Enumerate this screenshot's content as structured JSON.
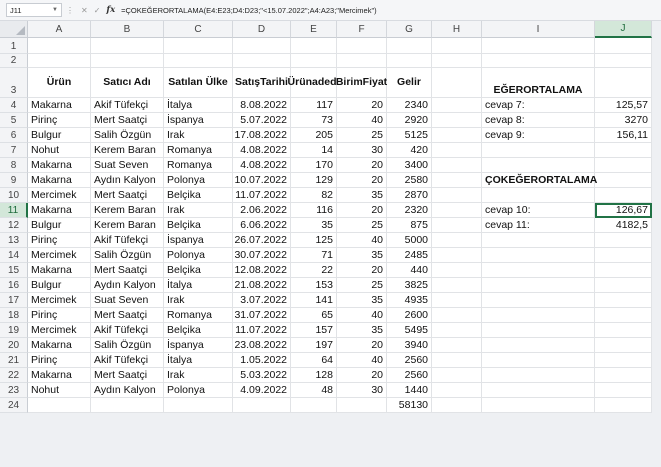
{
  "formula_bar": {
    "name_box": "J11",
    "fx": "fx",
    "formula": "=ÇOKEĞERORTALAMA(E4:E23;D4:D23;\"<15.07.2022\";A4:A23;\"Mercimek\")"
  },
  "columns": [
    "A",
    "B",
    "C",
    "D",
    "E",
    "F",
    "G",
    "H",
    "I",
    "J"
  ],
  "selected_column": "J",
  "selected_row": "11",
  "headers": {
    "urun": "Ürün",
    "satici": "Satıcı Adı",
    "ulke": "Satılan Ülke",
    "tarih_1": "Satış",
    "tarih_2": "Tarihi",
    "adet_1": "Ürün",
    "adet_2": "adedi",
    "fiyat_1": "Birim",
    "fiyat_2": "Fiyat",
    "gelir": "Gelir"
  },
  "rows": [
    [
      "Makarna",
      "Akif Tüfekçi",
      "İtalya",
      "8.08.2022",
      "117",
      "20",
      "2340"
    ],
    [
      "Pirinç",
      "Mert Saatçi",
      "İspanya",
      "5.07.2022",
      "73",
      "40",
      "2920"
    ],
    [
      "Bulgur",
      "Salih Özgün",
      "Irak",
      "17.08.2022",
      "205",
      "25",
      "5125"
    ],
    [
      "Nohut",
      "Kerem Baran",
      "Romanya",
      "4.08.2022",
      "14",
      "30",
      "420"
    ],
    [
      "Makarna",
      "Suat Seven",
      "Romanya",
      "4.08.2022",
      "170",
      "20",
      "3400"
    ],
    [
      "Makarna",
      "Aydın Kalyon",
      "Polonya",
      "10.07.2022",
      "129",
      "20",
      "2580"
    ],
    [
      "Mercimek",
      "Mert Saatçi",
      "Belçika",
      "11.07.2022",
      "82",
      "35",
      "2870"
    ],
    [
      "Makarna",
      "Kerem Baran",
      "Irak",
      "2.06.2022",
      "116",
      "20",
      "2320"
    ],
    [
      "Bulgur",
      "Kerem Baran",
      "Belçika",
      "6.06.2022",
      "35",
      "25",
      "875"
    ],
    [
      "Pirinç",
      "Akif Tüfekçi",
      "İspanya",
      "26.07.2022",
      "125",
      "40",
      "5000"
    ],
    [
      "Mercimek",
      "Salih Özgün",
      "Polonya",
      "30.07.2022",
      "71",
      "35",
      "2485"
    ],
    [
      "Makarna",
      "Mert Saatçi",
      "Belçika",
      "12.08.2022",
      "22",
      "20",
      "440"
    ],
    [
      "Bulgur",
      "Aydın Kalyon",
      "İtalya",
      "21.08.2022",
      "153",
      "25",
      "3825"
    ],
    [
      "Mercimek",
      "Suat Seven",
      "Irak",
      "3.07.2022",
      "141",
      "35",
      "4935"
    ],
    [
      "Pirinç",
      "Mert Saatçi",
      "Romanya",
      "31.07.2022",
      "65",
      "40",
      "2600"
    ],
    [
      "Mercimek",
      "Akif Tüfekçi",
      "Belçika",
      "11.07.2022",
      "157",
      "35",
      "5495"
    ],
    [
      "Makarna",
      "Salih Özgün",
      "İspanya",
      "23.08.2022",
      "197",
      "20",
      "3940"
    ],
    [
      "Pirinç",
      "Akif Tüfekçi",
      "İtalya",
      "1.05.2022",
      "64",
      "40",
      "2560"
    ],
    [
      "Makarna",
      "Mert Saatçi",
      "Irak",
      "5.03.2022",
      "128",
      "20",
      "2560"
    ],
    [
      "Nohut",
      "Aydın Kalyon",
      "Polonya",
      "4.09.2022",
      "48",
      "30",
      "1440"
    ]
  ],
  "total_gelir": "58130",
  "side": {
    "title1": "EĞERORTALAMA",
    "title2": "ÇOKEĞERORTALAMA",
    "labels": [
      "cevap 7:",
      "cevap 8:",
      "cevap 9:",
      "cevap 10:",
      "cevap 11:"
    ],
    "values": [
      "125,57",
      "3270",
      "156,11",
      "126,67",
      "4182,5"
    ]
  }
}
